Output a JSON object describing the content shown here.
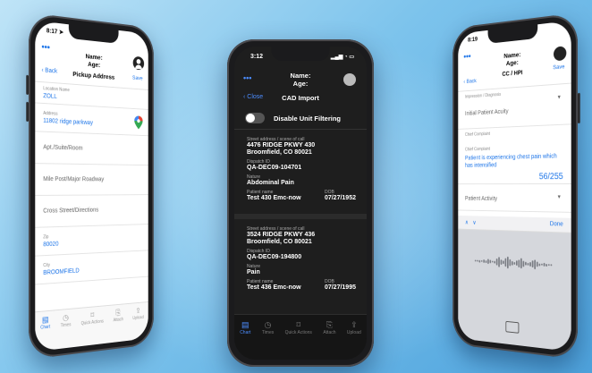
{
  "colors": {
    "accent": "#1a73e8",
    "dark_accent": "#4c8dff"
  },
  "tabs": [
    {
      "label": "Chart",
      "icon": "chart-icon"
    },
    {
      "label": "Times",
      "icon": "clock-icon"
    },
    {
      "label": "Quick Actions",
      "icon": "bookmark-icon"
    },
    {
      "label": "Attach",
      "icon": "paperclip-icon"
    },
    {
      "label": "Upload",
      "icon": "upload-icon"
    }
  ],
  "left": {
    "time": "8:17",
    "header": {
      "name": "Name:",
      "age": "Age:",
      "back": "Back",
      "title": "Pickup Address",
      "save": "Save",
      "dots": "•••"
    },
    "fields": [
      {
        "label": "Location Name",
        "value": "ZOLL"
      },
      {
        "label": "Address",
        "value": "11802 ridge parkway"
      },
      {
        "label": "",
        "placeholder": "Apt./Suite/Room"
      },
      {
        "label": "",
        "placeholder": "Mile Post/Major Roadway"
      },
      {
        "label": "",
        "placeholder": "Cross Street/Directions"
      },
      {
        "label": "Zip",
        "value": "80020"
      },
      {
        "label": "City",
        "value": "BROOMFIELD"
      }
    ]
  },
  "center": {
    "time": "3:12",
    "header": {
      "name": "Name:",
      "age": "Age:",
      "back": "Close",
      "title": "CAD Import",
      "dots": "•••"
    },
    "toggle_label": "Disable Unit Filtering",
    "calls": [
      {
        "address_label": "Street address / scene of call",
        "address": "4476 RIDGE PKWY 430",
        "city": "Broomfield, CO 80021",
        "dispatch_label": "Dispatch ID",
        "dispatch": "QA-DEC09-104701",
        "nature_label": "Nature",
        "nature": "Abdominal Pain",
        "patient_label": "Patient name",
        "patient": "Test 430 Emc-now",
        "dob_label": "DOB",
        "dob": "07/27/1952"
      },
      {
        "address_label": "Street address / scene of call",
        "address": "3524 RIDGE PKWY 436",
        "city": "Broomfield, CO 80021",
        "dispatch_label": "Dispatch ID",
        "dispatch": "QA-DEC09-194800",
        "nature_label": "Nature",
        "nature": "Pain",
        "patient_label": "Patient name",
        "patient": "Test 436 Emc-now",
        "dob_label": "DOB",
        "dob": "07/27/1995"
      }
    ]
  },
  "right": {
    "time": "8:19",
    "header": {
      "name": "Name:",
      "age": "Age:",
      "back": "Back",
      "title": "CC / HPI",
      "save": "Save",
      "dots": "•••"
    },
    "impression_label": "Impression / Diagnosis",
    "acuity_placeholder": "Initial Patient Acuity",
    "complaint_label": "Chief Complaint",
    "complaint_sub_label": "Chief Complaint",
    "complaint_text": "Patient is experiencing chest pain which has intensified",
    "counter": "56/255",
    "activity_placeholder": "Patient Activity",
    "kb_done": "Done"
  }
}
